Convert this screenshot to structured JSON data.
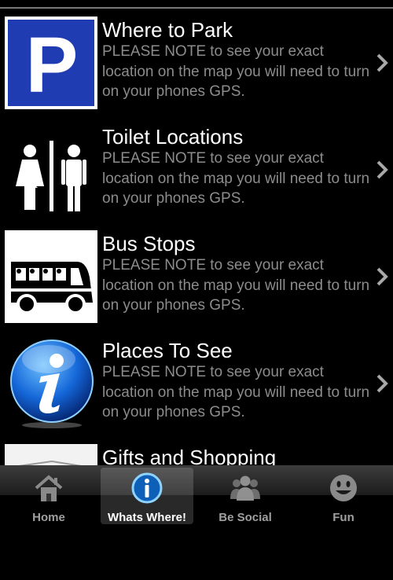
{
  "list": {
    "items": [
      {
        "title": "Where to Park",
        "description": "PLEASE NOTE to see your exact location on the map you will need to turn on your phones GPS.",
        "icon": "parking-sign-icon"
      },
      {
        "title": "Toilet Locations",
        "description": "PLEASE NOTE to see your exact location on the map you will need to turn on your phones GPS.",
        "icon": "restroom-icon"
      },
      {
        "title": "Bus Stops",
        "description": "PLEASE NOTE to see your exact location on the map you will need to turn on your phones GPS.",
        "icon": "bus-icon"
      },
      {
        "title": "Places To See",
        "description": "PLEASE NOTE to see your exact location on the map you will need to turn on your phones GPS.",
        "icon": "info-icon"
      },
      {
        "title": "Gifts and Shopping",
        "description": "",
        "icon": "gift-card-icon"
      }
    ]
  },
  "tabbar": {
    "tabs": [
      {
        "label": "Home",
        "icon": "house-icon",
        "active": false
      },
      {
        "label": "Whats Where!",
        "icon": "info-icon",
        "active": true
      },
      {
        "label": "Be Social",
        "icon": "people-icon",
        "active": false
      },
      {
        "label": "Fun",
        "icon": "smiley-icon",
        "active": false
      }
    ]
  },
  "colors": {
    "background": "#000000",
    "title": "#ffffff",
    "description": "#8c8c8c",
    "parking_blue": "#1f3cb3",
    "tab_label": "#a0a0a0"
  }
}
